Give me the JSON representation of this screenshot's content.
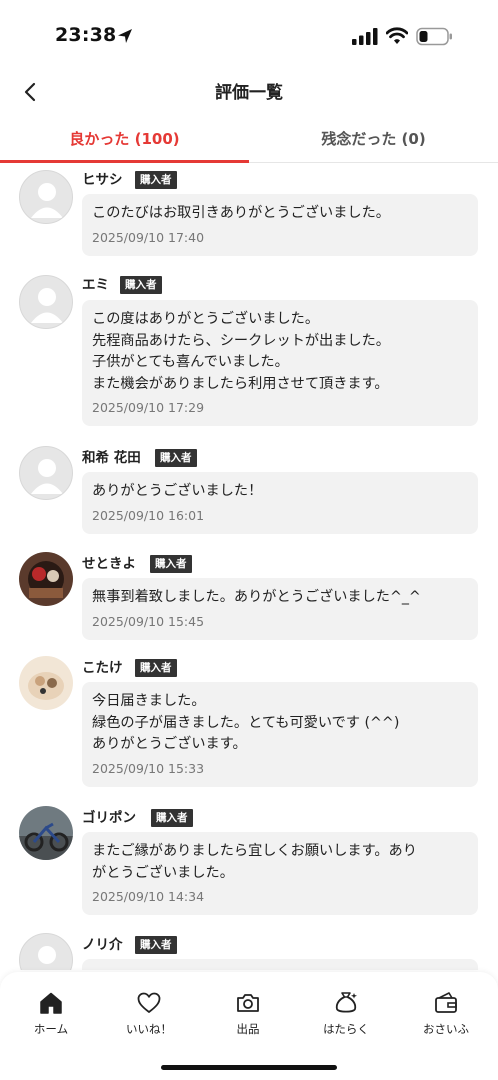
{
  "status_bar": {
    "time": "23:38"
  },
  "nav": {
    "title": "評価一覧"
  },
  "tabs": [
    {
      "label": "良かった (100)"
    },
    {
      "label": "残念だった (0)"
    }
  ],
  "reviews": [
    {
      "name": "ヒサシ",
      "badge": "購入者",
      "avatar": "default-avatar",
      "lines": [
        "このたびはお取引きありがとうございました。"
      ],
      "date": "2025/09/10 17:40"
    },
    {
      "name": "エミ",
      "badge": "購入者",
      "avatar": "default-avatar",
      "lines": [
        "この度はありがとうございました。",
        "先程商品あけたら、シークレットが出ました。",
        "子供がとても喜んでいました。",
        "また機会がありましたら利用させて頂きます。"
      ],
      "date": "2025/09/10 17:29"
    },
    {
      "name": "和希 花田",
      "badge": "購入者",
      "avatar": "default-avatar",
      "lines": [
        "ありがとうございました！"
      ],
      "date": "2025/09/10 16:01"
    },
    {
      "name": "せときよ",
      "badge": "購入者",
      "avatar": "photo-avatar",
      "lines": [
        "無事到着致しました。ありがとうございました^_^"
      ],
      "date": "2025/09/10 15:45"
    },
    {
      "name": "こたけ",
      "badge": "購入者",
      "avatar": "photo-avatar",
      "lines": [
        "今日届きました。",
        "緑色の子が届きました。とても可愛いです (^^)",
        "ありがとうございます。"
      ],
      "date": "2025/09/10 15:33"
    },
    {
      "name": "ゴリポン",
      "badge": "購入者",
      "avatar": "photo-avatar",
      "lines": [
        "またご縁がありましたら宜しくお願いします。あり",
        "がとうございました。"
      ],
      "date": "2025/09/10 14:34"
    },
    {
      "name": "ノリ介",
      "badge": "購入者",
      "avatar": "default-avatar",
      "lines": [],
      "date": ""
    }
  ],
  "bottom_nav": [
    {
      "label": "ホーム",
      "icon": "home-icon"
    },
    {
      "label": "いいね！",
      "icon": "heart-icon"
    },
    {
      "label": "出品",
      "icon": "camera-icon"
    },
    {
      "label": "はたらく",
      "icon": "money-bag-icon"
    },
    {
      "label": "おさいふ",
      "icon": "wallet-icon"
    }
  ],
  "colors": {
    "accent": "#e53935",
    "badge_bg": "#333333",
    "bubble_bg": "#f2f2f2"
  }
}
